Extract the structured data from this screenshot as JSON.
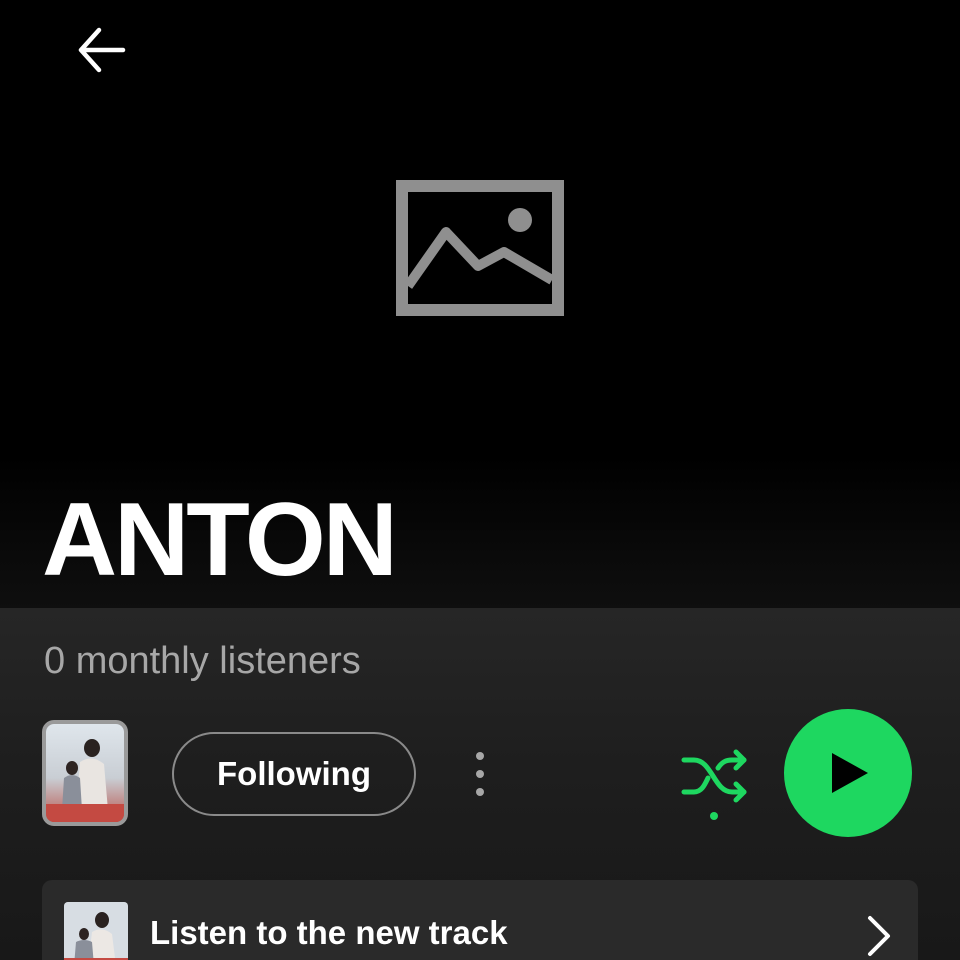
{
  "header": {
    "back_icon": "arrow-left-icon"
  },
  "hero": {
    "image_icon": "image-placeholder-icon",
    "artist_name": "ANTON"
  },
  "stats": {
    "monthly_listeners": "0 monthly listeners"
  },
  "actions": {
    "follow_label": "Following",
    "more_icon": "more-vertical-icon",
    "shuffle_icon": "shuffle-icon",
    "play_icon": "play-icon"
  },
  "promo": {
    "label": "Listen to the new track",
    "chevron_icon": "chevron-right-icon"
  },
  "colors": {
    "accent": "#1ed760",
    "background": "#000000",
    "surface": "#2a2a2a",
    "muted_text": "#a7a7a7"
  }
}
